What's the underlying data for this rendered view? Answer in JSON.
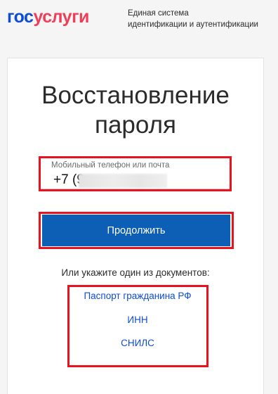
{
  "header": {
    "logo_part1": "гос",
    "logo_part2": "услуги",
    "subtitle_line1": "Единая система",
    "subtitle_line2": "идентификации и аутентификации"
  },
  "main": {
    "title_line1": "Восстановление",
    "title_line2": "пароля",
    "phone_field": {
      "label": "Мобильный телефон или почта",
      "value": "+7 (9"
    },
    "continue_label": "Продолжить",
    "docs_hint": "Или укажите один из документов:",
    "doc_links": [
      {
        "label": "Паспорт гражданина РФ"
      },
      {
        "label": "ИНН"
      },
      {
        "label": "СНИЛС"
      }
    ]
  },
  "colors": {
    "brand_blue": "#0d4cd3",
    "brand_red": "#ee3f58",
    "button_blue": "#0d5eb5",
    "annotation_red": "#e8131f"
  }
}
